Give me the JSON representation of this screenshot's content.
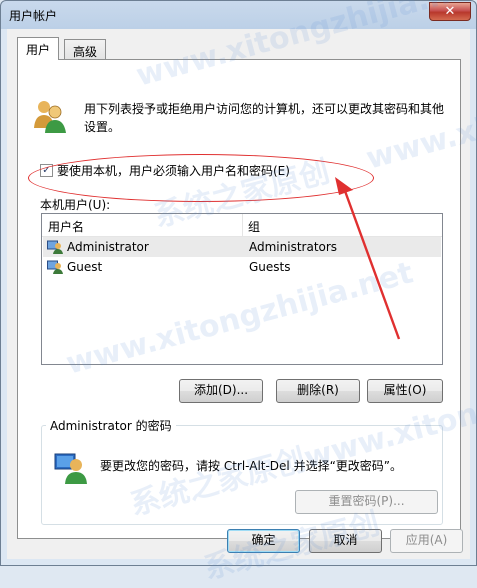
{
  "window": {
    "title": "用户帐户",
    "close_label": "✕"
  },
  "tabs": [
    {
      "label": "用户"
    },
    {
      "label": "高级"
    }
  ],
  "intro_text": "用下列表授予或拒绝用户访问您的计算机，还可以更改其密码和其他设置。",
  "require_login": {
    "label": "要使用本机，用户必须输入用户名和密码(E)",
    "checked": true,
    "mark": "✓"
  },
  "local_users": {
    "label": "本机用户(U):",
    "columns": {
      "name": "用户名",
      "group": "组"
    },
    "rows": [
      {
        "name": "Administrator",
        "group": "Administrators"
      },
      {
        "name": "Guest",
        "group": "Guests"
      }
    ]
  },
  "list_buttons": {
    "add": "添加(D)...",
    "remove": "删除(R)",
    "properties": "属性(O)"
  },
  "password_group": {
    "title": "Administrator 的密码",
    "text": "要更改您的密码，请按 Ctrl-Alt-Del 并选择“更改密码”。",
    "reset_button": "重置密码(P)..."
  },
  "dialog_buttons": {
    "ok": "确定",
    "cancel": "取消",
    "apply": "应用(A)"
  },
  "watermarks": [
    "www.xitongzhijia.net",
    "系统之家原创",
    "www.xitongzhijia.net",
    "系统之家原创www.xitongzhijia.net",
    "系统之家原创",
    "www.xitongzhijia.net"
  ],
  "colors": {
    "annotation": "#e03030",
    "selection": "#eaeaea",
    "title_bar": "#bcd0e7"
  }
}
